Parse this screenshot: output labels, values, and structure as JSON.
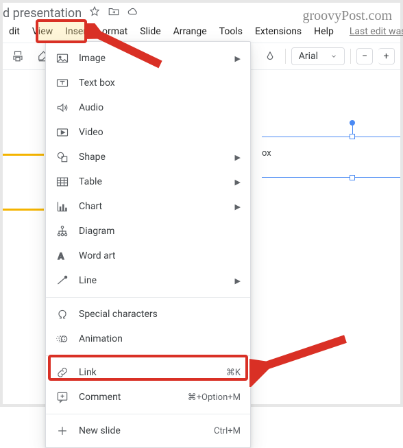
{
  "watermark": "groovyPost.com",
  "title_partial": "d presentation",
  "menus": {
    "edit_partial": "dit",
    "view": "View",
    "insert": "Insert",
    "format": "ormat",
    "slide": "Slide",
    "arrange": "Arrange",
    "tools": "Tools",
    "extensions": "Extensions",
    "help": "Help"
  },
  "last_edit": "Last edit was sec",
  "toolbar": {
    "font": "Arial"
  },
  "selection_label": "ox",
  "insert_menu": {
    "items": [
      {
        "key": "image",
        "label": "Image",
        "submenu": true,
        "shortcut": ""
      },
      {
        "key": "textbox",
        "label": "Text box",
        "submenu": false,
        "shortcut": ""
      },
      {
        "key": "audio",
        "label": "Audio",
        "submenu": false,
        "shortcut": ""
      },
      {
        "key": "video",
        "label": "Video",
        "submenu": false,
        "shortcut": ""
      },
      {
        "key": "shape",
        "label": "Shape",
        "submenu": true,
        "shortcut": ""
      },
      {
        "key": "table",
        "label": "Table",
        "submenu": true,
        "shortcut": ""
      },
      {
        "key": "chart",
        "label": "Chart",
        "submenu": true,
        "shortcut": ""
      },
      {
        "key": "diagram",
        "label": "Diagram",
        "submenu": false,
        "shortcut": ""
      },
      {
        "key": "wordart",
        "label": "Word art",
        "submenu": false,
        "shortcut": ""
      },
      {
        "key": "line",
        "label": "Line",
        "submenu": true,
        "shortcut": ""
      },
      {
        "key": "divider1",
        "divider": true
      },
      {
        "key": "specchar",
        "label": "Special characters",
        "submenu": false,
        "shortcut": ""
      },
      {
        "key": "anim",
        "label": "Animation",
        "submenu": false,
        "shortcut": ""
      },
      {
        "key": "divider2",
        "divider": true
      },
      {
        "key": "link",
        "label": "Link",
        "submenu": false,
        "shortcut": "⌘K"
      },
      {
        "key": "comment",
        "label": "Comment",
        "submenu": false,
        "shortcut": "⌘+Option+M"
      },
      {
        "key": "divider3",
        "divider": true
      },
      {
        "key": "newslide",
        "label": "New slide",
        "submenu": false,
        "shortcut": "Ctrl+M"
      }
    ]
  }
}
